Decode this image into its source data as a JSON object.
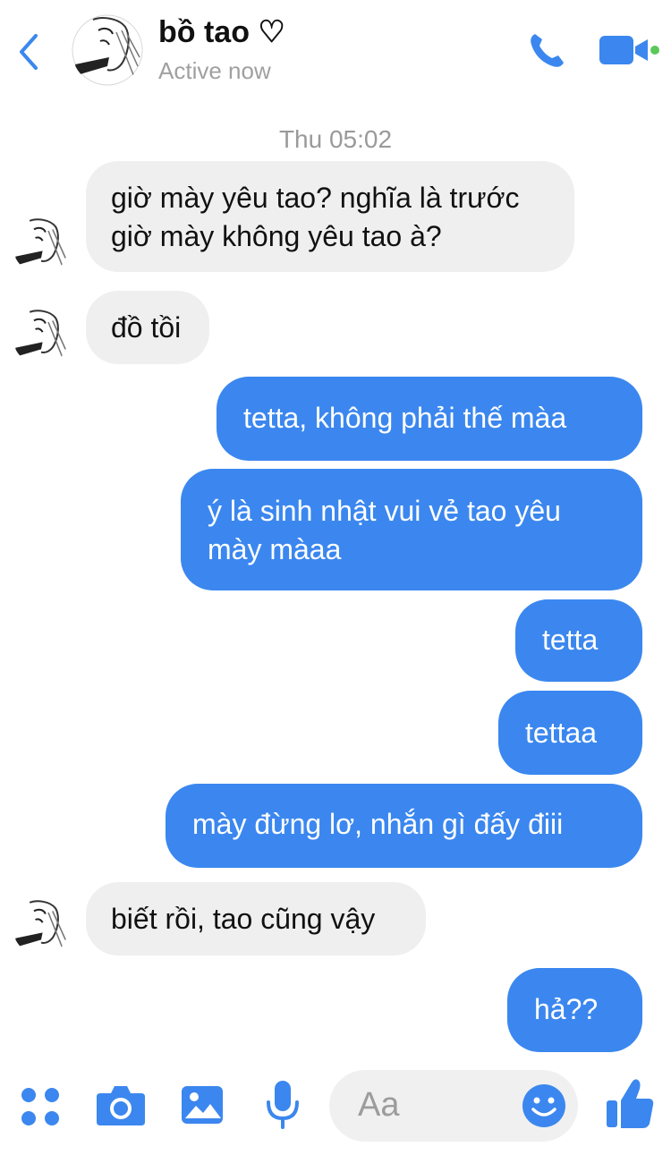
{
  "header": {
    "name": "bồ tao ♡",
    "status": "Active now"
  },
  "timestamp": "Thu 05:02",
  "messages": [
    {
      "from": "them",
      "text": "giờ mày yêu tao? nghĩa là trước giờ mày không yêu tao à?"
    },
    {
      "from": "them",
      "text": "đồ tồi"
    },
    {
      "from": "me",
      "text": "tetta, không phải thế màa"
    },
    {
      "from": "me",
      "text": "ý là sinh nhật vui vẻ tao yêu mày màaa"
    },
    {
      "from": "me",
      "text": "tetta"
    },
    {
      "from": "me",
      "text": "tettaa"
    },
    {
      "from": "me",
      "text": "mày đừng lơ, nhắn gì đấy điii"
    },
    {
      "from": "them",
      "text": "biết rồi, tao cũng vậy"
    },
    {
      "from": "me",
      "text": "hả??"
    }
  ],
  "composer": {
    "placeholder": "Aa"
  },
  "colors": {
    "accent": "#3b87ef",
    "incoming_bubble": "#efefef",
    "online": "#5ac85a"
  },
  "icons": [
    "chevron-left-icon",
    "phone-icon",
    "video-camera-icon",
    "apps-icon",
    "camera-icon",
    "image-icon",
    "microphone-icon",
    "emoji-icon",
    "thumbs-up-icon"
  ]
}
